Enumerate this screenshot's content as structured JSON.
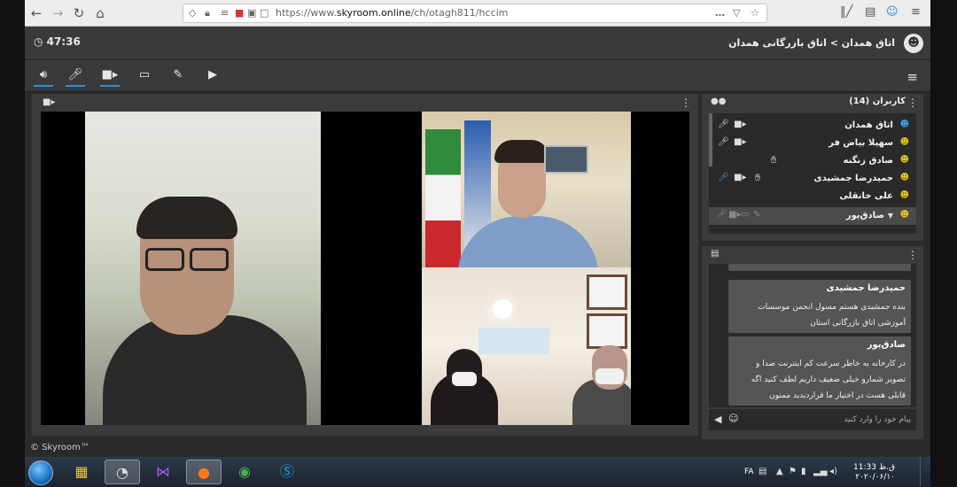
{
  "browser": {
    "url_prefix": "https://www.",
    "url_domain": "skyroom.online",
    "url_path": "/ch/otagh811/hccim",
    "icons": [
      "back-icon",
      "forward-icon",
      "reload-icon",
      "home-icon",
      "shield-icon",
      "lock-icon",
      "more-icon",
      "pocket-icon",
      "star-icon",
      "library-icon",
      "sidebar-icon",
      "account-icon",
      "menu-icon"
    ]
  },
  "header": {
    "timer": "47:36",
    "breadcrumb": "اتاق همدان > اتاق بازرگانی همدان"
  },
  "toolbar": {
    "tools": [
      "speaker-icon",
      "microphone-icon",
      "camera-icon",
      "screen-share-icon",
      "whiteboard-icon",
      "media-icon"
    ]
  },
  "users_panel": {
    "title": "کاربران (14)",
    "users": [
      {
        "name": "اتاق همدان",
        "role": "admin",
        "mic": true,
        "cam": true
      },
      {
        "name": "سهیلا بیاض فر",
        "role": "user",
        "mic": true,
        "cam": true
      },
      {
        "name": "صادق زنگنه",
        "role": "user",
        "hand": true
      },
      {
        "name": "حمیدرضا جمشیدی",
        "role": "user",
        "mic_active": true,
        "cam": true,
        "hand": true
      },
      {
        "name": "علی خانقلی",
        "role": "user"
      },
      {
        "name": "صادق‌پور",
        "role": "user",
        "selected": true
      }
    ]
  },
  "chat_panel": {
    "messages": [
      {
        "author": "حمیدرضا جمشیدی",
        "text": "بنده جمشیدی هستم مسول انجمن موسسات آموزشی اتاق بازرگانی استان"
      },
      {
        "author": "صادق‌پور",
        "text": "در کارخانه به خاطر سرعت کم اینترنت صدا و تصویر شمارو خیلی ضعیف داریم لطف کنید اگه قابلی هست در اختیار ما قراردبدید  ممنون"
      }
    ],
    "input_placeholder": "پیام خود را وارد کنید"
  },
  "footer": {
    "brand": "© Skyroom™"
  },
  "taskbar": {
    "apps": [
      "file-explorer-icon",
      "media-player-icon",
      "visual-studio-icon",
      "firefox-icon",
      "chrome-icon",
      "skype-icon"
    ],
    "lang": "FA",
    "time": "11:33 ق.ظ",
    "date": "۲۰۲۰/۰۶/۱۰"
  },
  "colors": {
    "accent": "#2b8fe0",
    "admin_icon": "#3d9ee8",
    "user_icon": "#e8c31c"
  }
}
